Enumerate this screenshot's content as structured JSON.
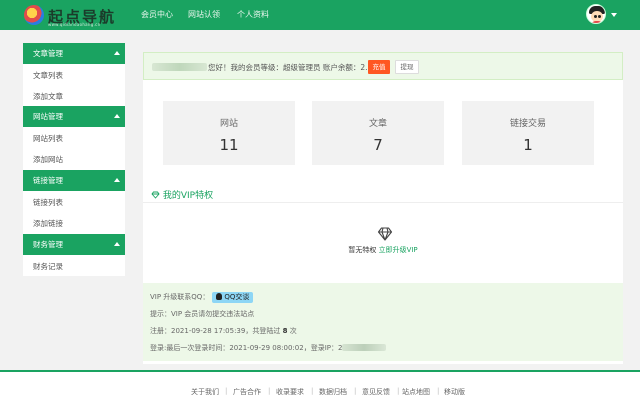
{
  "header": {
    "logo_text": "起点导航",
    "logo_sub": "www.qidiandaohang.cn",
    "nav": [
      "会员中心",
      "网站认领",
      "个人资料"
    ]
  },
  "sidebar": {
    "sections": [
      {
        "title": "文章管理",
        "items": [
          "文章列表",
          "添加文章"
        ]
      },
      {
        "title": "网站管理",
        "items": [
          "网站列表",
          "添加网站"
        ]
      },
      {
        "title": "链接管理",
        "items": [
          "链接列表",
          "添加链接"
        ]
      },
      {
        "title": "财务管理",
        "items": [
          "财务记录"
        ]
      }
    ]
  },
  "notice": {
    "text": "您好！我的会员等级：超级管理员 账户余额：2.00 元",
    "recharge_label": "充值",
    "withdraw_label": "提现"
  },
  "stats": [
    {
      "label": "网站",
      "value": "11"
    },
    {
      "label": "文章",
      "value": "7"
    },
    {
      "label": "链接交易",
      "value": "1"
    }
  ],
  "vip": {
    "title": "我的VIP特权",
    "empty_text": "暂无特权",
    "upgrade_link": "立即升级VIP"
  },
  "info": {
    "contact_label": "VIP 升级联系QQ：",
    "qq_button": "QQ交谈",
    "tip": "提示：VIP 会员请勿提交违法站点",
    "register_prefix": "注册：2021-09-28 17:05:39，共登陆过",
    "login_count": "8",
    "register_suffix": "次",
    "last_login": "登录:最后一次登录时间：2021-09-29 08:00:02，登录IP：2"
  },
  "footer": {
    "links": [
      "关于我们",
      "广告合作",
      "收录要求",
      "数据归档",
      "意见反馈",
      "站点地图",
      "移动版"
    ]
  },
  "colors": {
    "brand_green": "#1aa361",
    "recharge_orange": "#ff5722",
    "light_green": "#edf8e8"
  }
}
